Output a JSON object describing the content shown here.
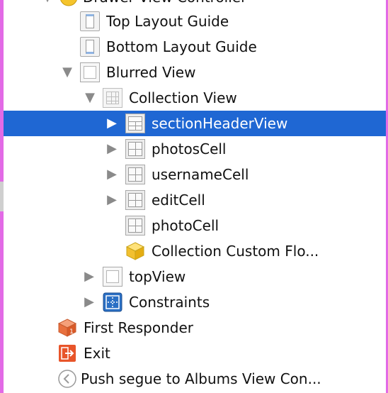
{
  "colors": {
    "selection": "#1f67d3",
    "edge_accent": "#e26ae6",
    "disclosure": "#8a8a8a"
  },
  "tree": {
    "partial_top": "Drawer View Controller",
    "items": [
      {
        "label": "Top Layout Guide",
        "icon": "top-layout-guide-icon"
      },
      {
        "label": "Bottom Layout Guide",
        "icon": "bottom-layout-guide-icon"
      },
      {
        "label": "Blurred View",
        "icon": "view-icon",
        "expanded": true
      },
      {
        "label": "Collection View",
        "icon": "collection-view-icon",
        "expanded": true
      },
      {
        "label": "sectionHeaderView",
        "icon": "collection-reusable-view-icon",
        "selected": true,
        "expanded": false
      },
      {
        "label": "photosCell",
        "icon": "collection-cell-icon",
        "expanded": false
      },
      {
        "label": "usernameCell",
        "icon": "collection-cell-icon",
        "expanded": false
      },
      {
        "label": "editCell",
        "icon": "collection-cell-icon",
        "expanded": false
      },
      {
        "label": "photoCell",
        "icon": "collection-cell-icon"
      },
      {
        "label": "Collection Custom Flo...",
        "icon": "object-cube-icon"
      },
      {
        "label": "topView",
        "icon": "view-icon",
        "expanded": false
      },
      {
        "label": "Constraints",
        "icon": "constraints-icon",
        "expanded": false
      },
      {
        "label": "First Responder",
        "icon": "first-responder-icon"
      },
      {
        "label": "Exit",
        "icon": "exit-icon"
      },
      {
        "label": "Push segue to Albums View Con...",
        "icon": "segue-icon"
      }
    ]
  }
}
